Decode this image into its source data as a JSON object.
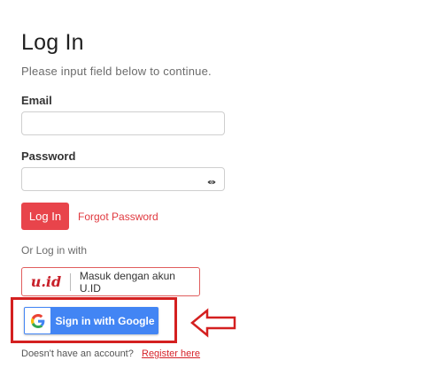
{
  "page": {
    "title": "Log In",
    "subtitle": "Please input field below to continue."
  },
  "form": {
    "email_label": "Email",
    "email_value": "",
    "password_label": "Password",
    "password_value": "",
    "password_toggle_icon": "eye-icon",
    "login_button": "Log In",
    "forgot_password": "Forgot Password"
  },
  "social": {
    "or_login_with": "Or Log in with",
    "uid_logo_text": "u.id",
    "uid_button": "Masuk dengan akun U.ID",
    "google_button": "Sign in with Google"
  },
  "footer": {
    "no_account_text": "Doesn't have an account?",
    "register_link": "Register here"
  },
  "annotation": {
    "highlight_color": "#d42020"
  },
  "colors": {
    "accent": "#e8444b",
    "google_blue": "#4285f4"
  }
}
